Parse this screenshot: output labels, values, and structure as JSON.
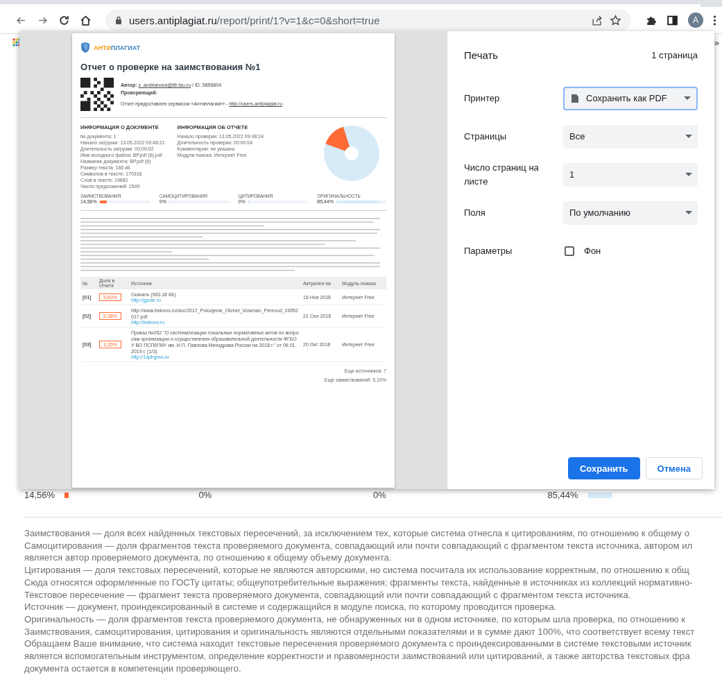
{
  "browser": {
    "url_host": "users.antiplagiat.ru",
    "url_path": "/report/print/1?v=1&c=0&short=true",
    "avatar": "A"
  },
  "bookmarks": {
    "more": "»"
  },
  "preview": {
    "logo": {
      "accent": "АНТИ",
      "rest": "ПЛАГИАТ"
    },
    "title": "Отчет о проверке на заимствования №1",
    "author_label": "Автор:",
    "author_link": "s_andrianova@lib.tsu.ru",
    "author_id": "/ ID: 5856804",
    "reviewer_label": "Проверяющий:",
    "service_text": "Отчет предоставлен сервисом «Антиплагиат» -",
    "service_link": "http://users.antiplagiat.ru",
    "doc_info": {
      "heading": "ИНФОРМАЦИЯ О ДОКУМЕНТЕ",
      "lines": [
        "№ документа: 1",
        "Начало загрузки: 13.05.2022 09:48:21",
        "Длительность загрузки: 00:00:02",
        "Имя исходного файла: ВР.pdf (6).pdf",
        "Название документа: ВР.pdf (6)",
        "Размер текста: 166 кБ",
        "Символов в тексте: 170316",
        "Слов в тексте: 19682",
        "Число предложений: 1549"
      ]
    },
    "report_info": {
      "heading": "ИНФОРМАЦИЯ ОБ ОТЧЕТЕ",
      "lines": [
        "Начало проверки: 13.05.2022 09:48:24",
        "Длительность проверки: 00:00:04",
        "Комментарии: не указано",
        "Модули поиска: Интернет Free"
      ]
    },
    "stats": [
      {
        "label": "ЗАИМСТВОВАНИЯ",
        "value": "14,56%",
        "level": 0.1456,
        "color": "#ff6b35"
      },
      {
        "label": "САМОЦИТИРОВАНИЯ",
        "value": "0%",
        "level": 0
      },
      {
        "label": "ЦИТИРОВАНИЯ",
        "value": "0%",
        "level": 0
      },
      {
        "label": "ОРИГИНАЛЬНОСТЬ",
        "value": "85,44%",
        "level": 0.8544,
        "color": "#d6eaf8"
      }
    ],
    "table": {
      "columns": [
        "№",
        "Доля в отчете",
        "Источник",
        "Актуален на",
        "Модуль поиска"
      ],
      "rows": [
        {
          "num": "[01]",
          "share": "5,60%",
          "source": "Скачать (963.18 КБ)",
          "link": "http://gpuie.ru",
          "date": "16 Ноя 2018",
          "module": "Интернет Free"
        },
        {
          "num": "[02]",
          "share": "5,38%",
          "source": "http://www.bekovo.ru/doc/2017_Polozjenie_Otchet_Vosenan_Perevod_19052017.pdf",
          "link": "http://bekovo.ru",
          "date": "21 Сен 2018",
          "module": "Интернет Free"
        },
        {
          "num": "[03]",
          "share": "3,35%",
          "source": "Приказ №052 \"О систематизации локальных нормативных актов по вопросам организации и осуществления образовательной деятельности ФГБОУ ВО ПСПбГМУ им. И.П. Павлова Минздрава России на 2018 г.\" от 09.01.2019 г. (1/3)",
          "link": "http://1spbgmu.ru",
          "date": "20 Окт 2018",
          "module": "Интернет Free"
        }
      ]
    },
    "more_sources": "Еще источников: 7",
    "more_borrowings": "Еще заимствований: 5,10%"
  },
  "print_panel": {
    "title": "Печать",
    "pages_count": "1 страница",
    "settings": [
      {
        "kind": "select",
        "label": "Принтер",
        "value": "Сохранить как PDF",
        "focused": true
      },
      {
        "kind": "select",
        "label": "Страницы",
        "value": "Все",
        "focused": false
      },
      {
        "kind": "select",
        "label": "Число страниц на листе",
        "value": "1",
        "focused": false
      },
      {
        "kind": "select",
        "label": "Поля",
        "value": "По умолчанию",
        "focused": false
      },
      {
        "kind": "checkbox",
        "label": "Параметры",
        "value": "Фон",
        "checked": false
      }
    ],
    "buttons": [
      {
        "label": "Сохранить",
        "primary": true
      },
      {
        "label": "Отмена",
        "primary": false
      }
    ]
  },
  "page": {
    "stats": [
      "14,56%",
      "0%",
      "0%",
      "85,44%"
    ],
    "glossary": [
      "Заимствования — доля всех найденных текстовых пересечений, за исключением тех, которые система отнесла к цитированиям, по отношению к общему о",
      "Самоцитирования — доля фрагментов текста проверяемого документа, совпадающий или почти совпадающий с фрагментом текста источника, автором ил",
      "является автор проверяемого документа, по отношению к общему объему документа.",
      "Цитирования — доля текстовых пересечений, которые не являются авторскими, но система посчитала их использование корректным, по отношению к общ",
      "Сюда относятся оформленные по ГОСТу цитаты; общеупотребительные выражения; фрагменты текста, найденные в источниках из коллекций нормативно-",
      "Текстовое пересечение — фрагмент текста проверяемого документа, совпадающий или почти совпадающий с фрагментом текста источника.",
      "Источник — документ, проиндексированный в системе и содержащийся в модуле поиска, по которому проводится проверка.",
      "Оригинальность — доля фрагментов текста проверяемого документа, не обнаруженных ни в одном источнике, по которым шла проверка, по отношению к",
      "Заимствования, самоцитирования, цитирования и оригинальность являются отдельными показателями и в сумме дают 100%, что соответствует всему текст",
      "Обращаем Ваше внимание, что система находит текстовые пересечения проверяемого документа с проиндексированными в системе текстовыми источник",
      "является вспомогательным инструментом, определение корректности и правомерности заимствований или цитирований, а также авторства текстовых фра",
      "документа остается в компетенции проверяющего."
    ]
  }
}
